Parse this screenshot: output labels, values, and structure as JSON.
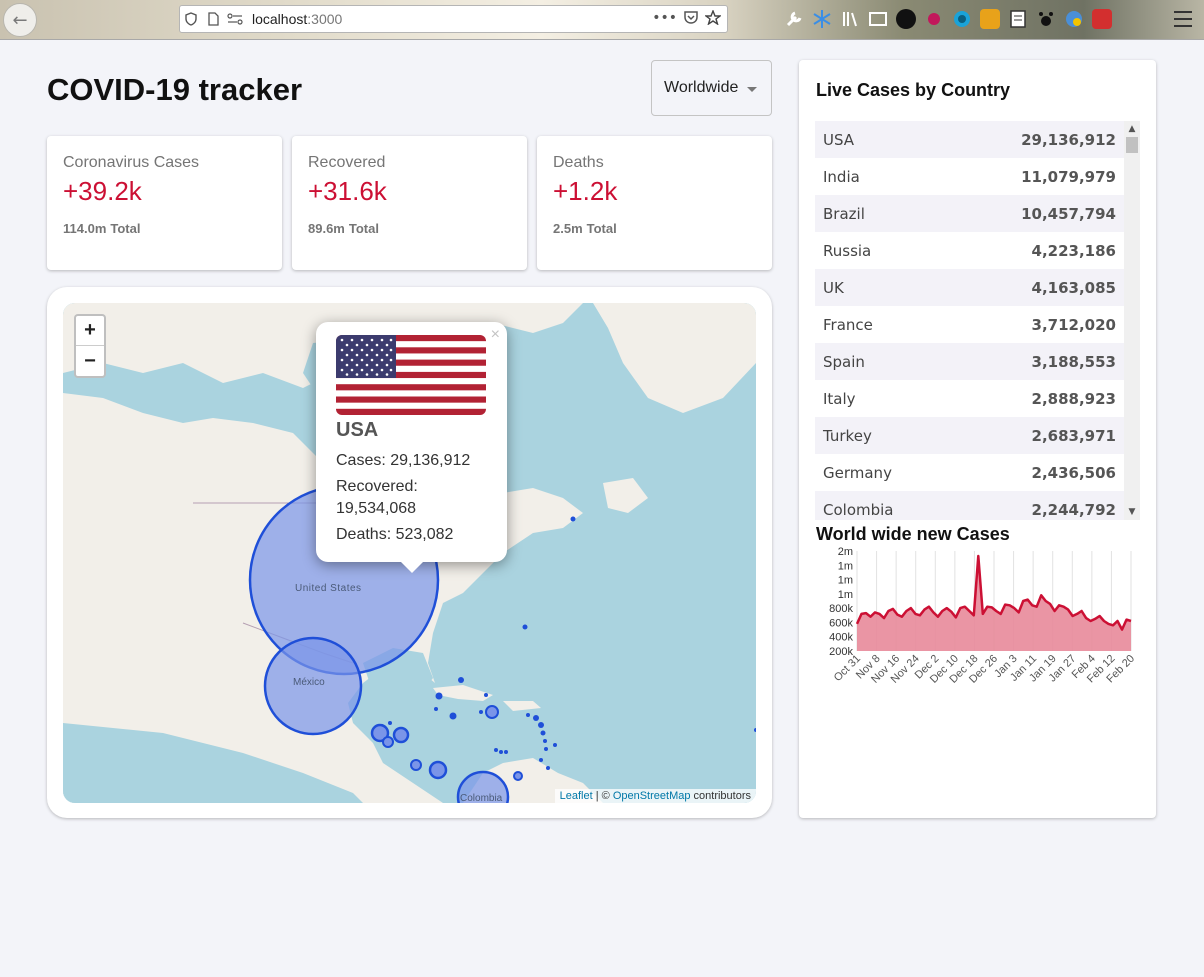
{
  "browser": {
    "url_host": "localhost",
    "url_port": ":3000"
  },
  "header": {
    "title": "COVID-19 tracker",
    "country_select": "Worldwide"
  },
  "stats": [
    {
      "label": "Coronavirus Cases",
      "value": "+39.2k",
      "total": "114.0m",
      "total_label": "Total"
    },
    {
      "label": "Recovered",
      "value": "+31.6k",
      "total": "89.6m",
      "total_label": "Total"
    },
    {
      "label": "Deaths",
      "value": "+1.2k",
      "total": "2.5m",
      "total_label": "Total"
    }
  ],
  "map": {
    "zoom_in": "+",
    "zoom_out": "−",
    "labels": {
      "usa": "United States",
      "mexico": "México",
      "colombia": "Colombia"
    },
    "attribution": {
      "leaflet": "Leaflet",
      "sep": " | © ",
      "osm": "OpenStreetMap",
      "suffix": " contributors"
    },
    "popup": {
      "close": "×",
      "country": "USA",
      "cases": "Cases: 29,136,912",
      "recovered": "Recovered: 19,534,068",
      "deaths": "Deaths: 523,082"
    },
    "colors": {
      "circle_fill": "#7b95e8",
      "circle_stroke": "#1f4fd8",
      "water": "#aad3df",
      "land": "#f2efe9"
    }
  },
  "live_cases": {
    "title": "Live Cases by Country",
    "rows": [
      {
        "country": "USA",
        "cases": "29,136,912"
      },
      {
        "country": "India",
        "cases": "11,079,979"
      },
      {
        "country": "Brazil",
        "cases": "10,457,794"
      },
      {
        "country": "Russia",
        "cases": "4,223,186"
      },
      {
        "country": "UK",
        "cases": "4,163,085"
      },
      {
        "country": "France",
        "cases": "3,712,020"
      },
      {
        "country": "Spain",
        "cases": "3,188,553"
      },
      {
        "country": "Italy",
        "cases": "2,888,923"
      },
      {
        "country": "Turkey",
        "cases": "2,683,971"
      },
      {
        "country": "Germany",
        "cases": "2,436,506"
      },
      {
        "country": "Colombia",
        "cases": "2,244,792"
      }
    ]
  },
  "chart_data": {
    "type": "area",
    "title": "World wide new Cases",
    "y_tick_labels": [
      "2m",
      "1m",
      "1m",
      "1m",
      "800k",
      "600k",
      "400k",
      "200k"
    ],
    "y_ticks": [
      1400000,
      1200000,
      1000000,
      800000,
      600000,
      400000,
      200000,
      0
    ],
    "x_tick_labels": [
      "Oct 31",
      "Nov 8",
      "Nov 16",
      "Nov 24",
      "Dec 2",
      "Dec 10",
      "Dec 18",
      "Dec 26",
      "Jan 3",
      "Jan 11",
      "Jan 19",
      "Jan 27",
      "Feb 4",
      "Feb 12",
      "Feb 20"
    ],
    "ylim": [
      0,
      1400000
    ],
    "x_days": [
      0,
      2,
      4,
      6,
      8,
      10,
      12,
      14,
      16,
      18,
      20,
      22,
      24,
      26,
      28,
      30,
      32,
      34,
      36,
      38,
      40,
      42,
      44,
      46,
      48,
      50,
      52,
      54,
      56,
      58,
      60,
      62,
      64,
      66,
      68,
      70,
      72,
      74,
      76,
      78,
      80,
      82,
      84,
      86,
      88,
      90,
      92,
      94,
      96,
      98,
      100,
      102,
      104,
      106,
      108,
      110,
      112,
      114,
      116,
      118,
      120,
      122
    ],
    "values": [
      380000,
      520000,
      530000,
      480000,
      540000,
      520000,
      460000,
      560000,
      590000,
      510000,
      480000,
      560000,
      600000,
      520000,
      500000,
      580000,
      620000,
      540000,
      480000,
      560000,
      600000,
      550000,
      470000,
      600000,
      620000,
      560000,
      500000,
      1330000,
      520000,
      620000,
      610000,
      560000,
      520000,
      650000,
      640000,
      600000,
      540000,
      700000,
      720000,
      640000,
      620000,
      780000,
      700000,
      660000,
      560000,
      640000,
      620000,
      580000,
      490000,
      520000,
      560000,
      460000,
      420000,
      450000,
      490000,
      420000,
      380000,
      360000,
      420000,
      300000,
      440000,
      420000
    ],
    "grid": true,
    "color": "#cc1034",
    "fill": "#e88a9a"
  }
}
